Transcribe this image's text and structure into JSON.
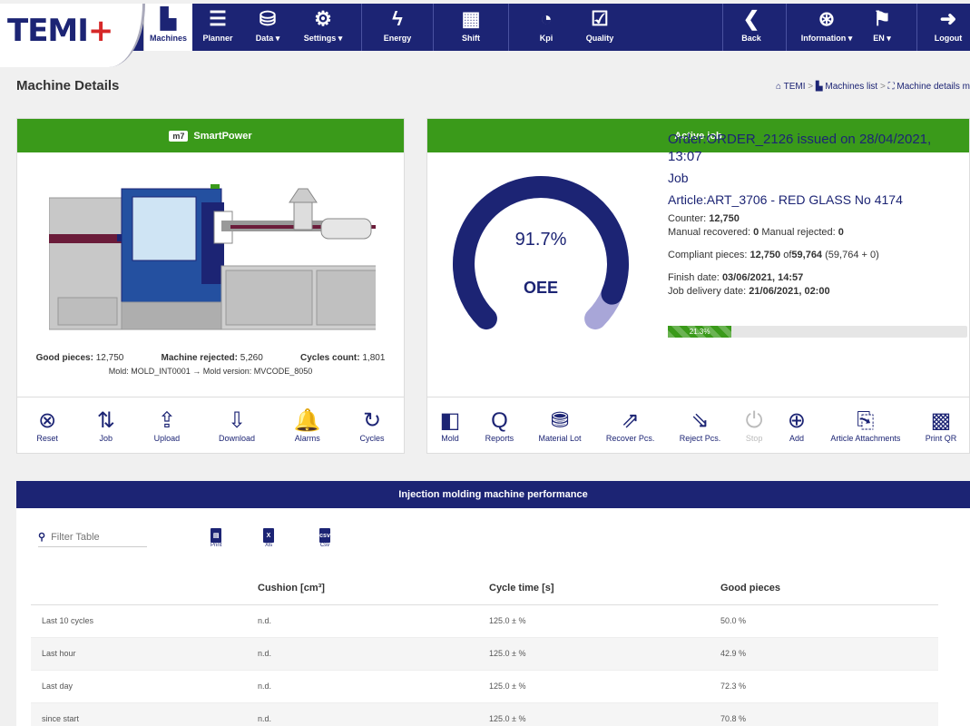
{
  "logo": {
    "text": "TEMI",
    "plus": "+"
  },
  "nav": {
    "machines": "Machines",
    "planner": "Planner",
    "data": "Data ▾",
    "settings": "Settings ▾",
    "energy": "Energy",
    "shift": "Shift",
    "kpi": "Kpi",
    "quality": "Quality",
    "back": "Back",
    "information": "Information ▾",
    "lang": "EN ▾",
    "logout": "Logout"
  },
  "page": {
    "title": "Machine Details"
  },
  "breadcrumb": {
    "home": "TEMI",
    "sep1": ">",
    "list": "Machines list",
    "sep2": ">",
    "current": "Machine details m"
  },
  "machine": {
    "badge": "m7",
    "name": "SmartPower",
    "good_label": "Good pieces:",
    "good_value": "12,750",
    "rejected_label": "Machine rejected:",
    "rejected_value": "5,260",
    "cycles_label": "Cycles count:",
    "cycles_value": "1,801",
    "mold_line": "Mold: MOLD_INT0001 → Mold version: MVCODE_8050",
    "actions": {
      "reset": "Reset",
      "job": "Job",
      "upload": "Upload",
      "download": "Download",
      "alarms": "Alarms",
      "cycles": "Cycles"
    }
  },
  "job": {
    "header": "Active job",
    "oee_value": "91.7%",
    "oee_fraction": 0.917,
    "oee_label": "OEE",
    "order": "Order:ORDER_2126 issued on 28/04/2021, 13:07",
    "job_label": "Job",
    "article": "Article:ART_3706 - RED GLASS No 4174",
    "counter_label": "Counter:",
    "counter_value": "12,750",
    "manual_rec_label": "Manual recovered:",
    "manual_rec_value": "0",
    "manual_rej_label": "Manual rejected:",
    "manual_rej_value": "0",
    "compliant_label": "Compliant pieces:",
    "compliant_value": "12,750",
    "compliant_of": "of",
    "compliant_total": "59,764",
    "compliant_extra": "(59,764 + 0)",
    "finish_label": "Finish date:",
    "finish_value": "03/06/2021, 14:57",
    "delivery_label": "Job delivery date:",
    "delivery_value": "21/06/2021, 02:00",
    "progress_text": "21.3%",
    "progress_fraction": 0.213,
    "actions": {
      "mold": "Mold",
      "reports": "Reports",
      "material": "Material Lot",
      "recover": "Recover Pcs.",
      "reject": "Reject Pcs.",
      "stop": "Stop",
      "add": "Add",
      "attachments": "Article Attachments",
      "printqr": "Print QR"
    }
  },
  "perf": {
    "header": "Injection molding machine performance",
    "filter_placeholder": "Filter Table",
    "print": "Print",
    "xls": "Xls",
    "csv": "Csv",
    "columns": [
      "",
      "Cushion [cm³]",
      "Cycle time [s]",
      "Good pieces"
    ],
    "rows": [
      [
        "Last 10 cycles",
        "n.d.",
        "125.0 ± %",
        "50.0 %"
      ],
      [
        "Last hour",
        "n.d.",
        "125.0 ± %",
        "42.9 %"
      ],
      [
        "Last day",
        "n.d.",
        "125.0 ± %",
        "72.3 %"
      ],
      [
        "since start",
        "n.d.",
        "125.0 ± %",
        "70.8 %"
      ]
    ]
  },
  "colors": {
    "navy": "#1c2474",
    "green": "#3a9a1a",
    "gauge_light": "#a8a6d8"
  }
}
